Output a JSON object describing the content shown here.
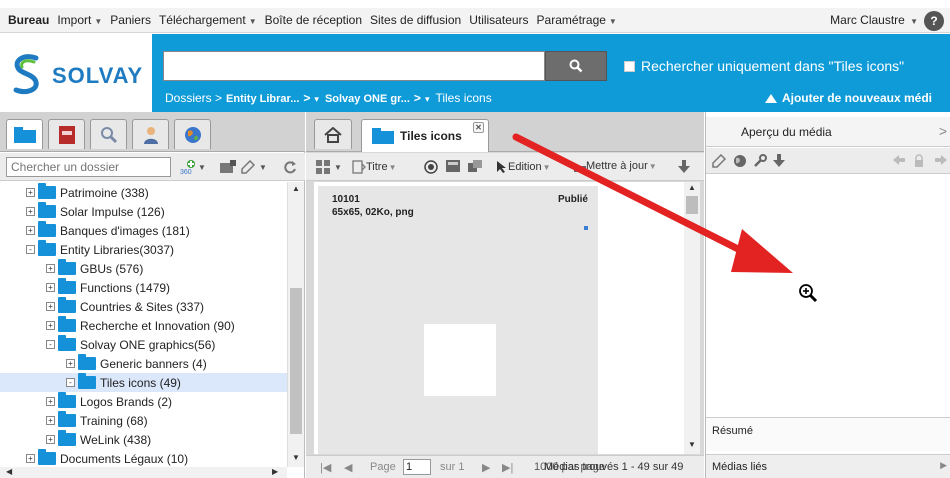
{
  "topmenu": {
    "items": [
      {
        "label": "Bureau",
        "bold": true,
        "caret": false
      },
      {
        "label": "Import",
        "caret": true
      },
      {
        "label": "Paniers",
        "caret": false
      },
      {
        "label": "Téléchargement",
        "caret": true
      },
      {
        "label": "Boîte de réception",
        "caret": false
      },
      {
        "label": "Sites de diffusion",
        "caret": false
      },
      {
        "label": "Utilisateurs",
        "caret": false
      },
      {
        "label": "Paramétrage",
        "caret": true
      }
    ],
    "user": "Marc Claustre",
    "help_label": "?"
  },
  "header": {
    "logo_text": "SOLVAY",
    "search_value": "",
    "scope_label": "Rechercher uniquement dans \"Tiles icons\"",
    "breadcrumb": [
      "Dossiers >",
      "Entity Librar...",
      ">",
      "Solvay ONE gr...",
      ">",
      "Tiles icons"
    ],
    "add_media": "Ajouter de nouveaux médi"
  },
  "left": {
    "folder_search_placeholder": "Chercher un dossier",
    "tool_360": "360",
    "tree": [
      {
        "label": "Patrimoine (338)",
        "level": 0,
        "sign": "+"
      },
      {
        "label": "Solar Impulse (126)",
        "level": 0,
        "sign": "+"
      },
      {
        "label": "Banques d'images (181)",
        "level": 0,
        "sign": "+"
      },
      {
        "label": "Entity Libraries(3037)",
        "level": 0,
        "sign": "-"
      },
      {
        "label": "GBUs (576)",
        "level": 1,
        "sign": "+"
      },
      {
        "label": "Functions (1479)",
        "level": 1,
        "sign": "+"
      },
      {
        "label": "Countries & Sites (337)",
        "level": 1,
        "sign": "+"
      },
      {
        "label": "Recherche et Innovation (90)",
        "level": 1,
        "sign": "+"
      },
      {
        "label": "Solvay ONE graphics(56)",
        "level": 1,
        "sign": "-"
      },
      {
        "label": "Generic banners (4)",
        "level": 2,
        "sign": "+"
      },
      {
        "label": "Tiles icons (49)",
        "level": 2,
        "sign": "-",
        "selected": true
      },
      {
        "label": "Logos Brands (2)",
        "level": 1,
        "sign": "+"
      },
      {
        "label": "Training (68)",
        "level": 1,
        "sign": "+"
      },
      {
        "label": "WeLink (438)",
        "level": 1,
        "sign": "+"
      },
      {
        "label": "Documents Légaux (10)",
        "level": 0,
        "sign": "+"
      }
    ]
  },
  "center": {
    "tab_label": "Tiles icons",
    "toolbar": {
      "titre": "Titre",
      "edition": "Edition",
      "mettre": "Mettre à jour"
    },
    "card": {
      "id": "10101",
      "status": "Publié",
      "info": "65x65, 02Ko, png"
    },
    "pager": {
      "page_label": "Page",
      "page_value": "1",
      "of_label": "sur 1",
      "per_page": "1000 par page",
      "medias_label": "Médias trouvés 1 - 49 sur 49"
    }
  },
  "right": {
    "preview_title": "Aperçu du média",
    "summary_title": "Résumé",
    "linked_title": "Médias liés"
  },
  "colors": {
    "header_blue": "#0f9bd8",
    "folder_blue": "#1591d9",
    "arrow_red": "#e32222"
  }
}
